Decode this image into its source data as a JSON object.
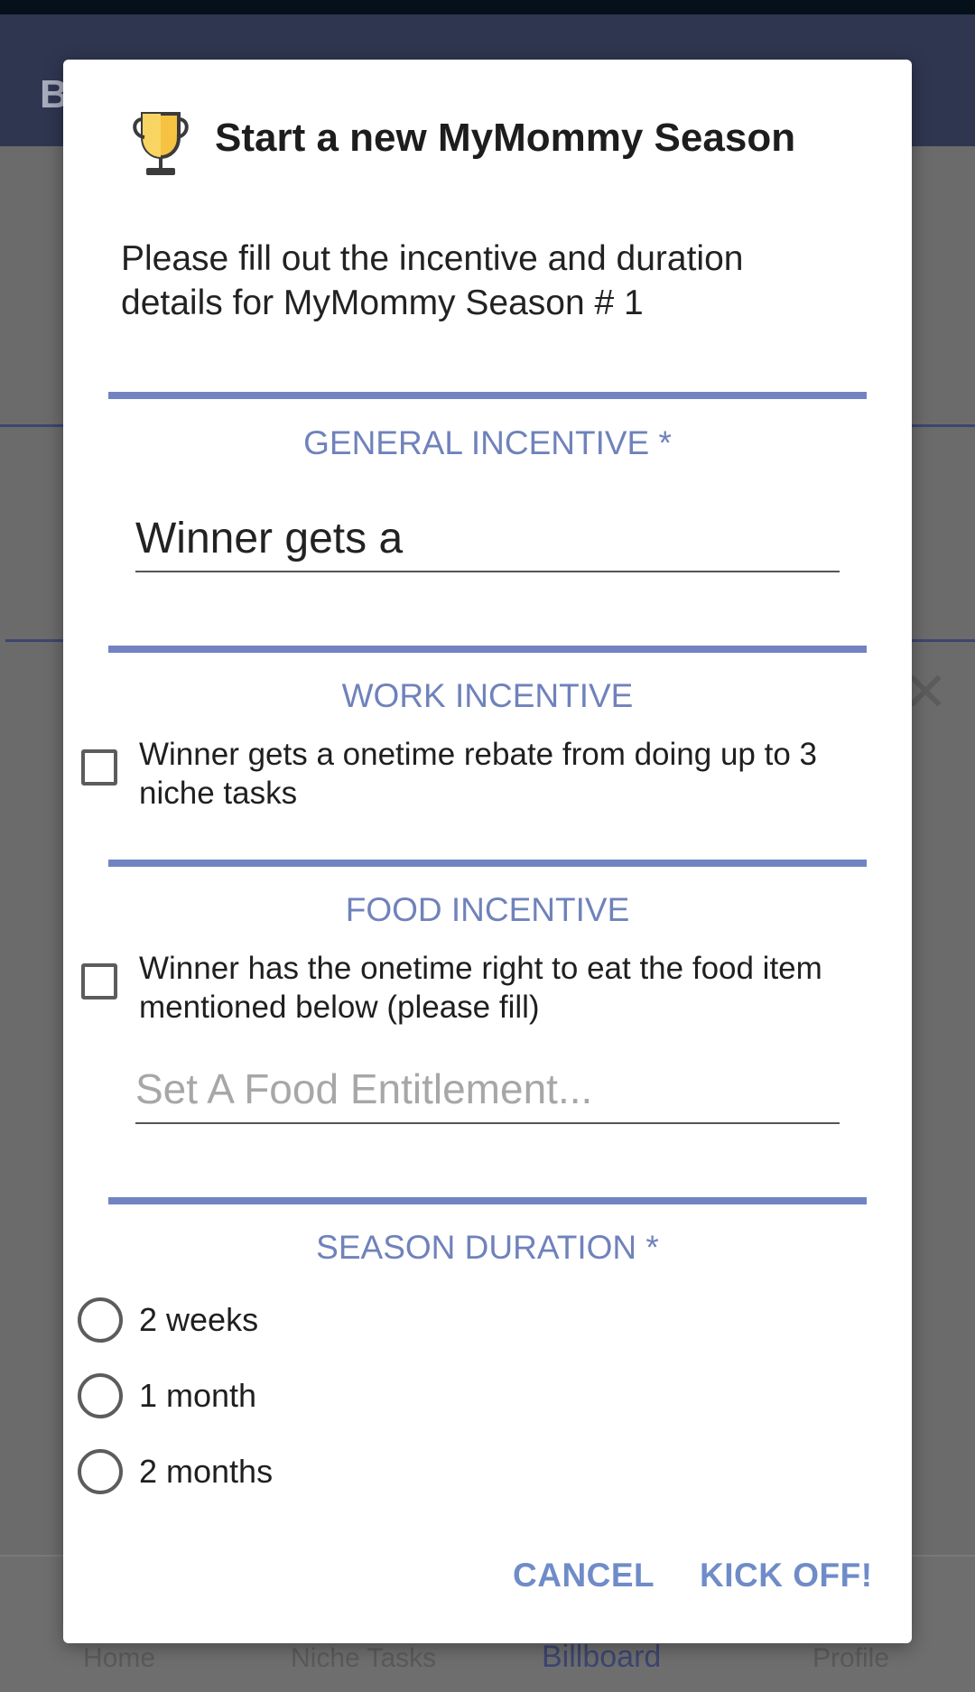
{
  "background": {
    "app_title_initial": "B",
    "bottom_nav": [
      "Home",
      "Niche Tasks",
      "Billboard",
      "Profile"
    ]
  },
  "dialog": {
    "icon": "trophy-icon",
    "title": "Start a new MyMommy Season",
    "intro": "Please fill out the incentive and duration details for MyMommy Season # 1",
    "general_incentive": {
      "heading": "GENERAL INCENTIVE *",
      "value": "Winner gets a"
    },
    "work_incentive": {
      "heading": "WORK INCENTIVE",
      "checkbox_label": "Winner gets a onetime rebate from doing up to 3 niche tasks",
      "checked": false
    },
    "food_incentive": {
      "heading": "FOOD INCENTIVE",
      "checkbox_label": "Winner has the onetime right to eat the food item mentioned below (please fill)",
      "checked": false,
      "placeholder": "Set A Food Entitlement..."
    },
    "season_duration": {
      "heading": "SEASON DURATION *",
      "options": [
        "2 weeks",
        "1 month",
        "2 months"
      ]
    },
    "buttons": {
      "cancel": "CANCEL",
      "confirm": "KICK OFF!"
    }
  },
  "colors": {
    "accent": "#7183c3",
    "button_text": "#6f8cc8",
    "trophy_gold": "#f5c242"
  }
}
